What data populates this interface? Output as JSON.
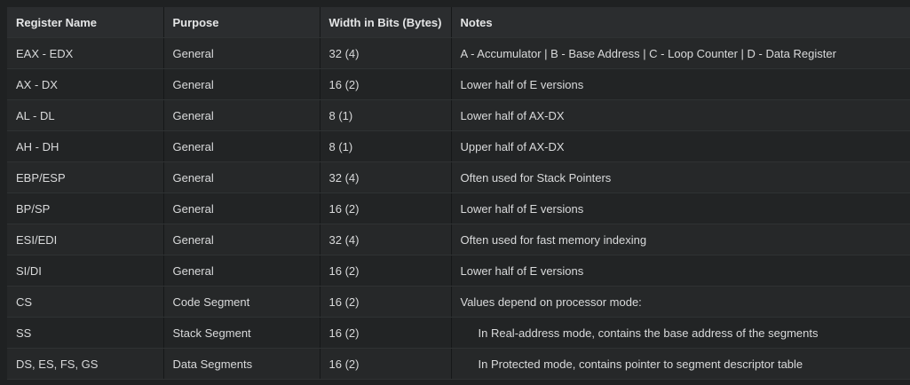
{
  "table": {
    "headers": [
      "Register Name",
      "Purpose",
      "Width in Bits (Bytes)",
      "Notes"
    ],
    "rows": [
      {
        "name": "EAX - EDX",
        "purpose": "General",
        "width": "32 (4)",
        "notes": "A - Accumulator | B - Base Address | C - Loop Counter | D - Data Register"
      },
      {
        "name": "AX - DX",
        "purpose": "General",
        "width": "16 (2)",
        "notes": "Lower half of E versions"
      },
      {
        "name": "AL - DL",
        "purpose": "General",
        "width": "8 (1)",
        "notes": "Lower half of AX-DX"
      },
      {
        "name": "AH - DH",
        "purpose": "General",
        "width": "8 (1)",
        "notes": "Upper half of AX-DX"
      },
      {
        "name": "EBP/ESP",
        "purpose": "General",
        "width": "32 (4)",
        "notes": "Often used for Stack Pointers"
      },
      {
        "name": "BP/SP",
        "purpose": "General",
        "width": "16 (2)",
        "notes": "Lower half of E versions"
      },
      {
        "name": "ESI/EDI",
        "purpose": "General",
        "width": "32 (4)",
        "notes": "Often used for fast memory indexing"
      },
      {
        "name": "SI/DI",
        "purpose": "General",
        "width": "16 (2)",
        "notes": "Lower half of E versions"
      },
      {
        "name": "CS",
        "purpose": "Code Segment",
        "width": "16 (2)",
        "notes": "Values depend on processor mode:"
      },
      {
        "name": "SS",
        "purpose": "Stack Segment",
        "width": "16 (2)",
        "notes": "In Real-address mode, contains the base address of the segments"
      },
      {
        "name": "DS, ES, FS, GS",
        "purpose": "Data Segments",
        "width": "16 (2)",
        "notes": "In Protected mode, contains pointer to segment descriptor table"
      }
    ]
  }
}
